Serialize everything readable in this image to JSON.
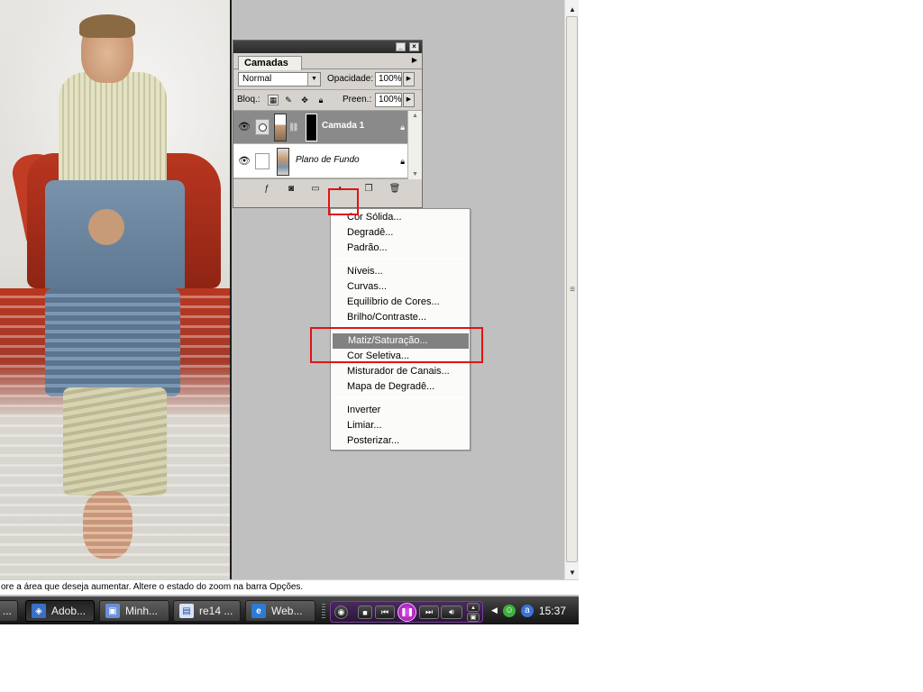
{
  "layers_panel": {
    "tab_label": "Camadas",
    "blend_mode": "Normal",
    "opacity_label": "Opacidade:",
    "opacity_value": "100%",
    "lock_label": "Bloq.:",
    "fill_label": "Preen.:",
    "fill_value": "100%",
    "layers": [
      {
        "name": "Camada 1",
        "selected": true,
        "visible": true,
        "locked": true
      },
      {
        "name": "Plano de Fundo",
        "selected": false,
        "visible": true,
        "locked": true
      }
    ]
  },
  "adjustment_menu": {
    "groups": [
      [
        "Cor Sólida...",
        "Degradê...",
        "Padrão..."
      ],
      [
        "Níveis...",
        "Curvas...",
        "Equilíbrio de Cores...",
        "Brilho/Contraste..."
      ],
      [
        "Matiz/Saturação...",
        "Cor Seletiva...",
        "Misturador de Canais...",
        "Mapa de Degradê..."
      ],
      [
        "Inverter",
        "Limiar...",
        "Posterizar..."
      ]
    ],
    "highlighted_item": "Matiz/Saturação..."
  },
  "status_bar": {
    "text": "ore a área que deseja aumentar. Altere o estado do zoom na barra Opções."
  },
  "taskbar": {
    "tasks": [
      {
        "label": "...",
        "active": false
      },
      {
        "label": "Adob...",
        "active": true
      },
      {
        "label": "Minh...",
        "active": false
      },
      {
        "label": "re14 ...",
        "active": false
      },
      {
        "label": "Web...",
        "active": false
      }
    ],
    "clock": "15:37"
  },
  "colors": {
    "highlight_red": "#e01414",
    "menu_highlight": "#818181",
    "selected_layer": "#8a8a8a",
    "media_accent": "#9e1fb0"
  }
}
